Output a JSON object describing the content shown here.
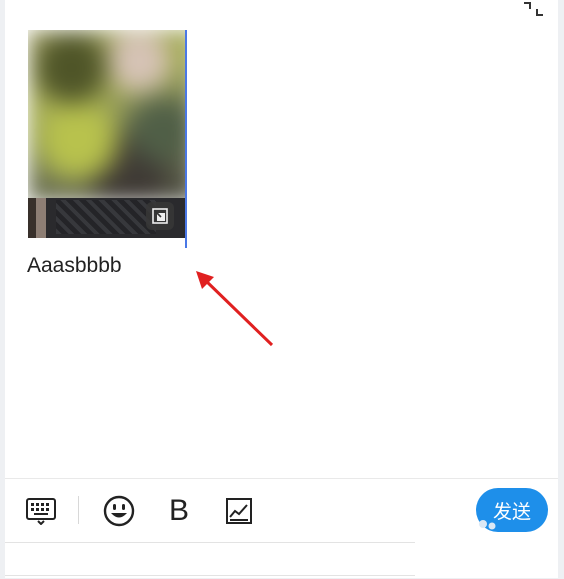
{
  "editor": {
    "body_text": "Aaasbbbb"
  },
  "toolbar": {
    "bold_label": "B",
    "send_label": "发送"
  },
  "icons": {
    "collapse": "collapse-icon",
    "expand": "expand-image-icon",
    "keyboard": "keyboard-icon",
    "emoji": "emoji-icon",
    "chart": "chart-icon"
  },
  "colors": {
    "accent": "#1e8fea",
    "cursor": "#4a78e6",
    "annotation_arrow": "#e02020"
  }
}
